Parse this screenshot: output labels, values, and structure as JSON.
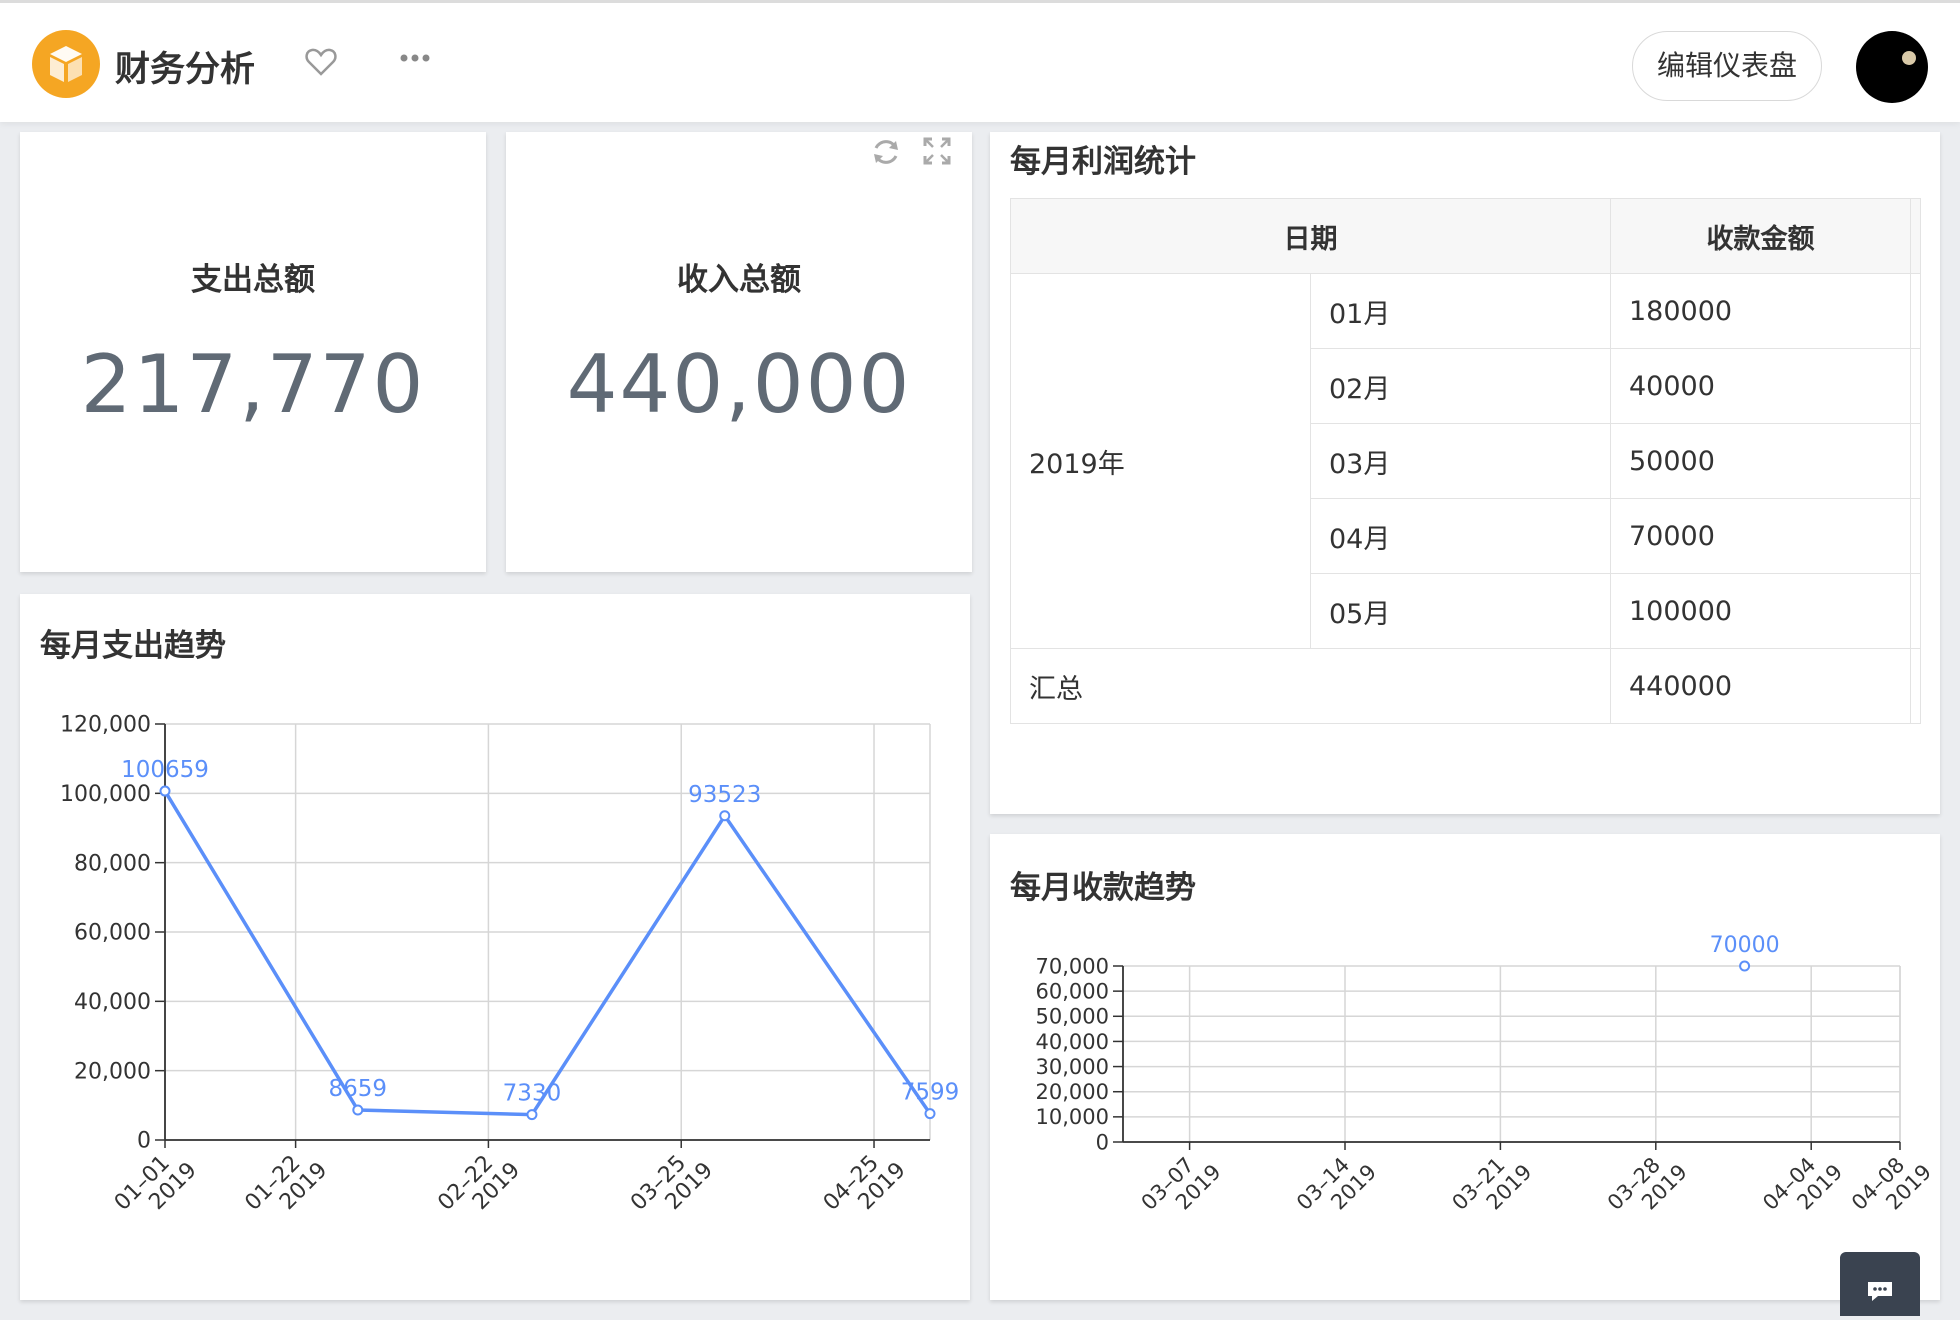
{
  "header": {
    "title": "财务分析",
    "edit_label": "编辑仪表盘",
    "brand_color": "#f5a623"
  },
  "kpis": [
    {
      "label": "支出总额",
      "value": "217,770"
    },
    {
      "label": "收入总额",
      "value": "440,000"
    }
  ],
  "profit_table": {
    "title": "每月利润统计",
    "headers": [
      "日期",
      "收款金额"
    ],
    "year": "2019年",
    "rows": [
      {
        "month": "01月",
        "amount": "180000"
      },
      {
        "month": "02月",
        "amount": "40000"
      },
      {
        "month": "03月",
        "amount": "50000"
      },
      {
        "month": "04月",
        "amount": "70000"
      },
      {
        "month": "05月",
        "amount": "100000"
      }
    ],
    "total_label": "汇总",
    "total_value": "440000"
  },
  "chart_data": [
    {
      "type": "line",
      "title": "每月支出趋势",
      "series_color": "#5b8ff9",
      "ylim": [
        0,
        120000
      ],
      "yticks": [
        0,
        20000,
        40000,
        60000,
        80000,
        100000,
        120000
      ],
      "ytick_labels": [
        "0",
        "20,000",
        "40,000",
        "60,000",
        "80,000",
        "100,000",
        "120,000"
      ],
      "xlim": [
        "2019-01-01",
        "2019-05-04"
      ],
      "xticks": [
        "2019-01-01",
        "2019-01-22",
        "2019-02-22",
        "2019-03-25",
        "2019-04-25"
      ],
      "xtick_labels": [
        [
          "01–01",
          "2019"
        ],
        [
          "01–22",
          "2019"
        ],
        [
          "02–22",
          "2019"
        ],
        [
          "03–25",
          "2019"
        ],
        [
          "04–25",
          "2019"
        ]
      ],
      "points": [
        {
          "x": "2019-01-01",
          "y": 100659,
          "label": "100659"
        },
        {
          "x": "2019-02-01",
          "y": 8659,
          "label": "8659"
        },
        {
          "x": "2019-03-01",
          "y": 7330,
          "label": "7330"
        },
        {
          "x": "2019-04-01",
          "y": 93523,
          "label": "93523"
        },
        {
          "x": "2019-05-04",
          "y": 7599,
          "label": "7599"
        }
      ],
      "grid": true
    },
    {
      "type": "scatter",
      "title": "每月收款趋势",
      "series_color": "#5b8ff9",
      "ylim": [
        0,
        70000
      ],
      "yticks": [
        0,
        10000,
        20000,
        30000,
        40000,
        50000,
        60000,
        70000
      ],
      "ytick_labels": [
        "0",
        "10,000",
        "20,000",
        "30,000",
        "40,000",
        "50,000",
        "60,000",
        "70,000"
      ],
      "xlim": [
        "2019-03-04",
        "2019-04-08"
      ],
      "xticks": [
        "2019-03-07",
        "2019-03-14",
        "2019-03-21",
        "2019-03-28",
        "2019-04-04",
        "2019-04-08"
      ],
      "xtick_labels": [
        [
          "03–07",
          "2019"
        ],
        [
          "03–14",
          "2019"
        ],
        [
          "03–21",
          "2019"
        ],
        [
          "03–28",
          "2019"
        ],
        [
          "04–04",
          "2019"
        ],
        [
          "04–08",
          "2019"
        ]
      ],
      "points": [
        {
          "x": "2019-04-01",
          "y": 70000,
          "label": "70000"
        }
      ],
      "grid": true
    }
  ]
}
